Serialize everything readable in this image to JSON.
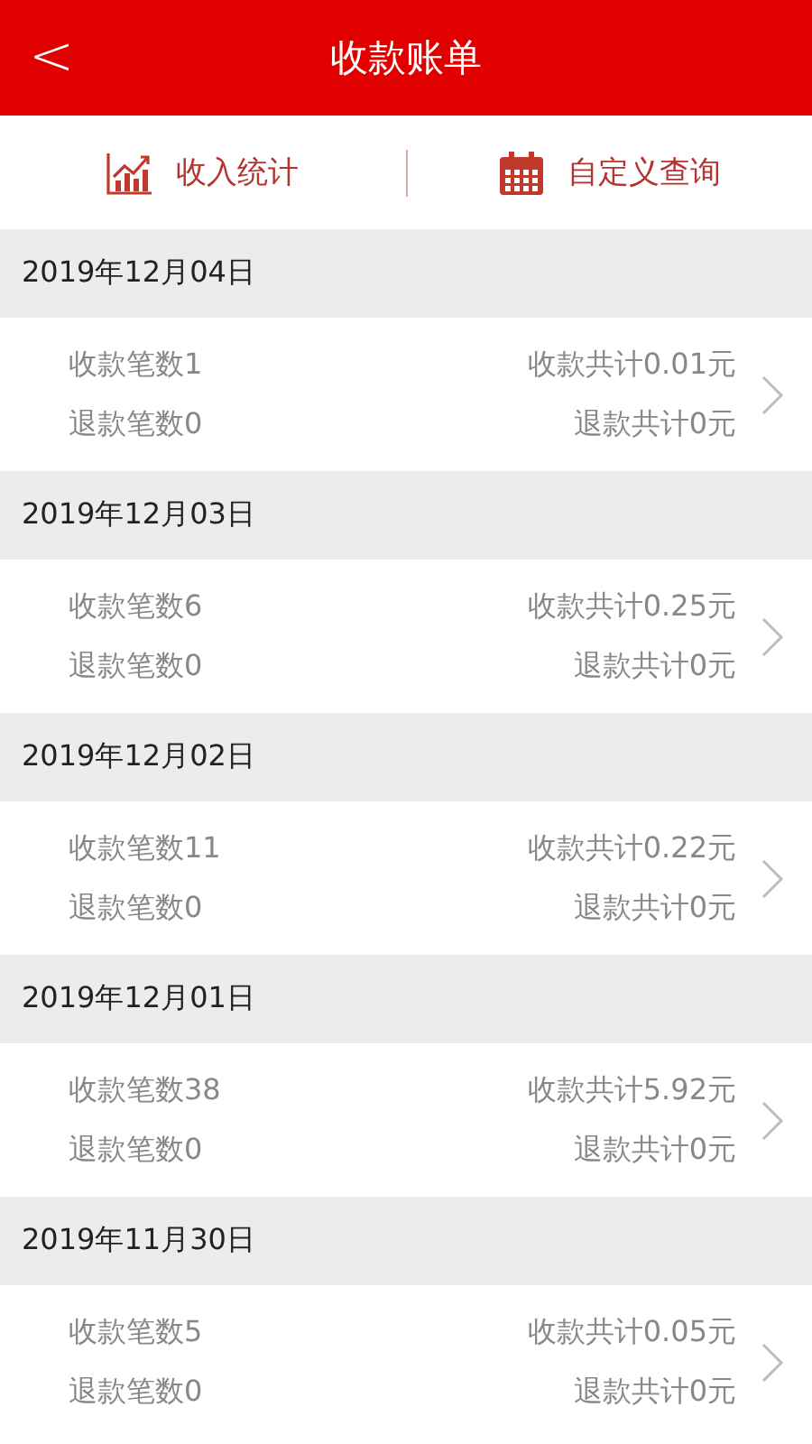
{
  "header": {
    "back": "<",
    "title": "收款账单"
  },
  "toolbar": [
    {
      "kind": "chart",
      "label": "收入统计"
    },
    {
      "kind": "calendar",
      "label": "自定义查询"
    }
  ],
  "days": [
    {
      "date": "2019年12月04日",
      "receipt_count": "收款笔数1",
      "receipt_total": "收款共计0.01元",
      "refund_count": "退款笔数0",
      "refund_total": "退款共计0元"
    },
    {
      "date": "2019年12月03日",
      "receipt_count": "收款笔数6",
      "receipt_total": "收款共计0.25元",
      "refund_count": "退款笔数0",
      "refund_total": "退款共计0元"
    },
    {
      "date": "2019年12月02日",
      "receipt_count": "收款笔数11",
      "receipt_total": "收款共计0.22元",
      "refund_count": "退款笔数0",
      "refund_total": "退款共计0元"
    },
    {
      "date": "2019年12月01日",
      "receipt_count": "收款笔数38",
      "receipt_total": "收款共计5.92元",
      "refund_count": "退款笔数0",
      "refund_total": "退款共计0元"
    },
    {
      "date": "2019年11月30日",
      "receipt_count": "收款笔数5",
      "receipt_total": "收款共计0.05元",
      "refund_count": "退款笔数0",
      "refund_total": "退款共计0元"
    }
  ]
}
